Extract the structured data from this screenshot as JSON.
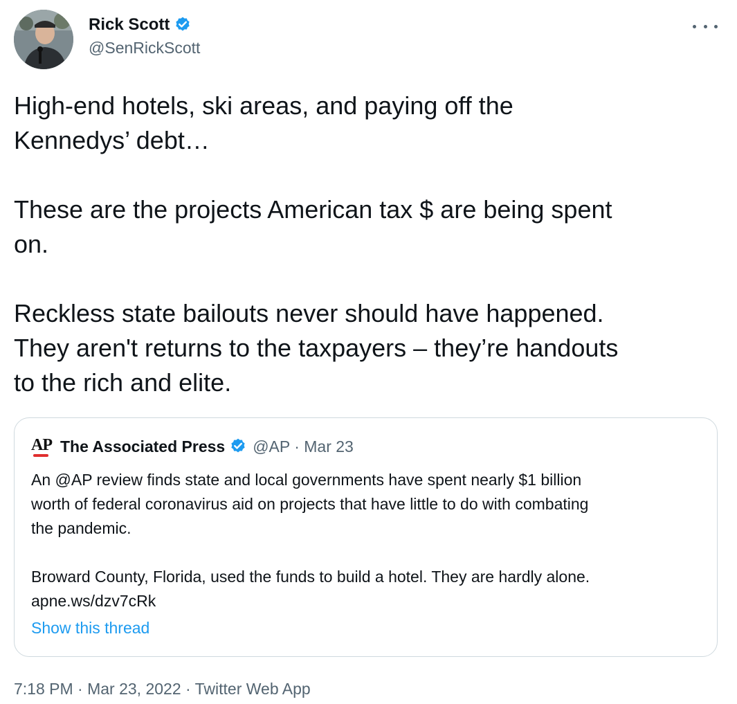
{
  "author": {
    "display_name": "Rick Scott",
    "handle": "@SenRickScott",
    "verified": true
  },
  "tweet": {
    "text": "High-end hotels, ski areas, and paying off the\nKennedys’ debt…\n\nThese are the projects American tax $ are being spent\non.\n\nReckless state bailouts never should have happened.\nThey aren't returns to the taxpayers – they’re handouts\nto the rich and elite."
  },
  "quoted": {
    "logo_text": "AP",
    "display_name": "The Associated Press",
    "meta": "@AP · Mar 23",
    "text": "An @AP review finds state and local governments have spent nearly $1 billion\nworth of federal coronavirus aid on projects that have little to do with combating\nthe pandemic.\n\nBroward County, Florida, used the funds to build a hotel. They are hardly alone.\napne.ws/dzv7cRk",
    "show_thread": "Show this thread"
  },
  "footer": {
    "meta": "7:18 PM · Mar 23, 2022 · Twitter Web App"
  },
  "colors": {
    "accent": "#1d9bf0",
    "secondary_text": "#536471",
    "border": "#cfd9de",
    "ap_red": "#e02f2f"
  }
}
